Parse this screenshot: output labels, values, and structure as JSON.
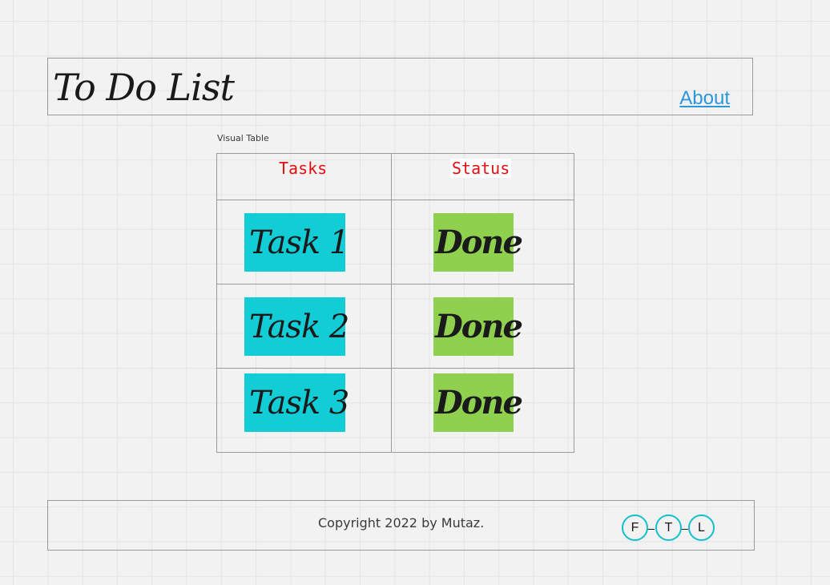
{
  "header": {
    "title": "To Do List",
    "about_label": "About"
  },
  "table": {
    "caption": "Visual Table",
    "headers": {
      "tasks": "Tasks",
      "status": "Status"
    },
    "rows": [
      {
        "task": "Task 1",
        "status": "Done"
      },
      {
        "task": "Task 2",
        "status": "Done"
      },
      {
        "task": "Task 3",
        "status": "Done"
      }
    ]
  },
  "footer": {
    "copyright": "Copyright 2022 by Mutaz.",
    "social": [
      "F",
      "T",
      "L"
    ]
  },
  "colors": {
    "header_text": "#e01010",
    "task_sticky": "#12ccd6",
    "status_sticky": "#8fd14f",
    "link": "#2c96dd",
    "social_ring": "#12c0cc"
  }
}
